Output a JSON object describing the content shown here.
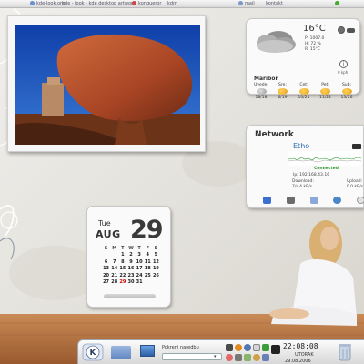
{
  "top_bar": {
    "items": [
      "kde-look.org",
      "kde - look - kde desktop artwork",
      "konqueror",
      "kdm",
      "mail",
      "kontakt"
    ]
  },
  "weather": {
    "temperature": "16°C",
    "details": [
      "P: 1007.0",
      "H: 72 %",
      "R: 15°C"
    ],
    "city": "Maribor",
    "wind": "0 kph",
    "forecast": [
      {
        "day": "Uvede:",
        "range": "18/18",
        "icon": "cloudy-icon"
      },
      {
        "day": "Sre:",
        "range": "6/19",
        "icon": "sun-icon"
      },
      {
        "day": "Cet:",
        "range": "10/21",
        "icon": "sun-icon"
      },
      {
        "day": "Pet:",
        "range": "11/22",
        "icon": "sun-icon"
      },
      {
        "day": "Sub:",
        "range": "13/26",
        "icon": "sun-icon"
      }
    ]
  },
  "network": {
    "title": "Network",
    "interface": "Etho",
    "status": "Connected",
    "ip": "Ip: 192.168.43.16",
    "download_label": "Download:",
    "download_value": "7/s 4 kB/s",
    "upload_label": "Upload:",
    "upload_value": "0.0 kB/s"
  },
  "calendar": {
    "weekday": "Tue",
    "month": "AUG",
    "day": "29",
    "headers": [
      "S",
      "M",
      "T",
      "W",
      "T",
      "F",
      "S"
    ],
    "days": [
      "",
      "",
      "1",
      "2",
      "3",
      "4",
      "5",
      "6",
      "7",
      "8",
      "9",
      "10",
      "11",
      "12",
      "13",
      "14",
      "15",
      "16",
      "17",
      "18",
      "19",
      "20",
      "21",
      "22",
      "23",
      "24",
      "25",
      "26",
      "27",
      "28",
      "29",
      "30",
      "31",
      "",
      ""
    ],
    "today": "29"
  },
  "taskbar": {
    "search_label": "Pokreni naredbu",
    "clock": "22:08:08",
    "weekday": "UTORAK",
    "date": "29.08.2006"
  },
  "colors": {
    "accent_blue": "#2a6db5",
    "connected_green": "#2b9a2b",
    "today_red": "#cc0000"
  }
}
